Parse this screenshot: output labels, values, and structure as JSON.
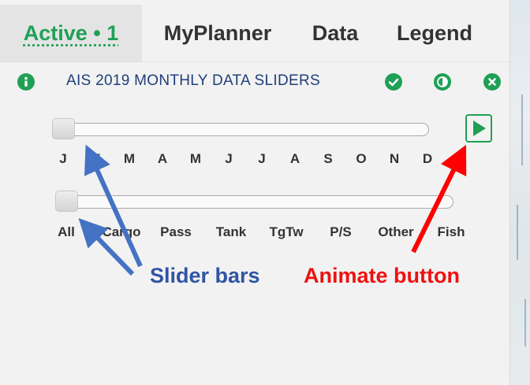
{
  "tabs": [
    {
      "label": "Active • 1",
      "active": true
    },
    {
      "label": "MyPlanner",
      "active": false
    },
    {
      "label": "Data",
      "active": false
    },
    {
      "label": "Legend",
      "active": false
    }
  ],
  "panel": {
    "title": "AIS 2019 MONTHLY DATA SLIDERS",
    "icons": [
      "info-icon",
      "check-circle-icon",
      "contrast-icon",
      "close-circle-icon"
    ]
  },
  "month_slider": {
    "labels": [
      "J",
      "F",
      "M",
      "A",
      "M",
      "J",
      "J",
      "A",
      "S",
      "O",
      "N",
      "D"
    ],
    "selected_index": 0
  },
  "vessel_slider": {
    "labels": [
      "All",
      "Cargo",
      "Pass",
      "Tank",
      "TgTw",
      "P/S",
      "Other",
      "Fish"
    ],
    "selected_index": 0
  },
  "annotations": {
    "slider_bars": "Slider bars",
    "animate_button": "Animate button"
  },
  "colors": {
    "accent_green": "#1fa055",
    "title_blue": "#1f3f7a",
    "annotation_blue": "#2f55a4",
    "annotation_red": "#ee1111"
  }
}
